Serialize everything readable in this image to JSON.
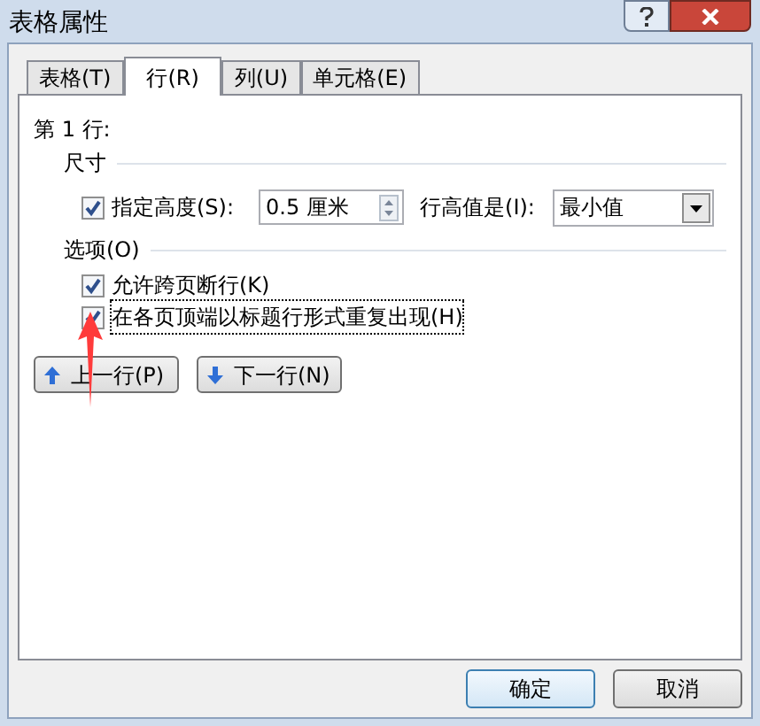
{
  "window": {
    "title": "表格属性"
  },
  "tabs": [
    {
      "label": "表格(T)",
      "selected": false
    },
    {
      "label": "行(R)",
      "selected": true
    },
    {
      "label": "列(U)",
      "selected": false
    },
    {
      "label": "单元格(E)",
      "selected": false
    }
  ],
  "row_heading": "第 1 行:",
  "size_section": {
    "title": "尺寸",
    "height_checkbox": {
      "label": "指定高度(S):",
      "checked": true
    },
    "height_value": "0.5 厘米",
    "mode_label": "行高值是(I):",
    "mode_value": "最小值"
  },
  "options_section": {
    "title": "选项(O)",
    "options": [
      {
        "label": "允许跨页断行(K)",
        "checked": true
      },
      {
        "label": "在各页顶端以标题行形式重复出现(H)",
        "checked": true
      }
    ]
  },
  "nav_buttons": [
    {
      "label": "上一行(P)",
      "kind": "up"
    },
    {
      "label": "下一行(N)",
      "kind": "down"
    }
  ],
  "buttons": [
    "确定",
    "取消"
  ]
}
